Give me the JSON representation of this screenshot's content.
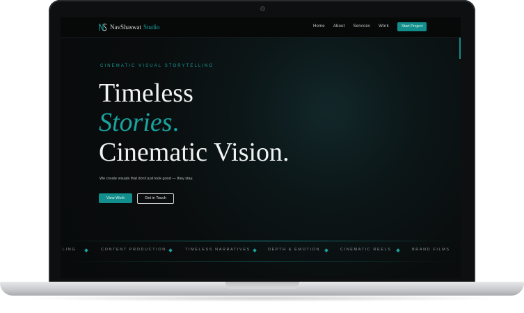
{
  "nav": {
    "logo_name": "NavShaswat",
    "logo_accent": "Studio",
    "links": [
      "Home",
      "About",
      "Services",
      "Work"
    ],
    "cta": "Start Project"
  },
  "hero": {
    "eyebrow": "CINEMATIC VISUAL STORYTELLING",
    "line1": "Timeless",
    "line2": "Stories",
    "line2_dot": ".",
    "line3": "Cinematic Vision",
    "line3_dot": ".",
    "tagline": "We create visuals that don't just look good — they stay.",
    "primary_button": "View Work",
    "secondary_button": "Get in Touch"
  },
  "marquee": {
    "items": [
      "LING",
      "CONTENT PRODUCTION",
      "TIMELESS NARRATIVES",
      "DEPTH & EMOTION",
      "CINEMATIC REELS",
      "BRAND FILMS"
    ]
  },
  "colors": {
    "accent": "#1aa3a0",
    "background": "#0a0d0e",
    "text": "#f1f3f3"
  }
}
